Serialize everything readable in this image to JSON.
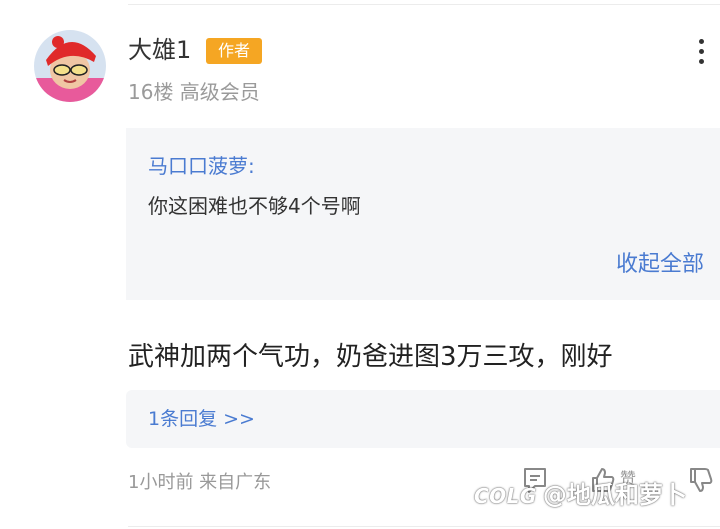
{
  "post": {
    "username": "大雄1",
    "badge": "作者",
    "floor_level": "16楼 高级会员",
    "quote": {
      "author": "马口口菠萝:",
      "text": "你这困难也不够4个号啊",
      "collapse_label": "收起全部"
    },
    "comment": "武神加两个气功，奶爸进图3万三攻，刚好",
    "replies_label": "1条回复 >>",
    "meta": "1小时前 来自广东",
    "like_label": "赞"
  },
  "watermark": {
    "logo": "COLG",
    "handle": "@地瓜和萝卜"
  },
  "icons": [
    "avatar",
    "more-icon",
    "comment-icon",
    "like-icon",
    "dislike-icon"
  ],
  "colors": {
    "badge": "#f5a623",
    "link": "#4a7bd1",
    "quote_background": "#f5f6f8",
    "muted_text": "#999999"
  }
}
